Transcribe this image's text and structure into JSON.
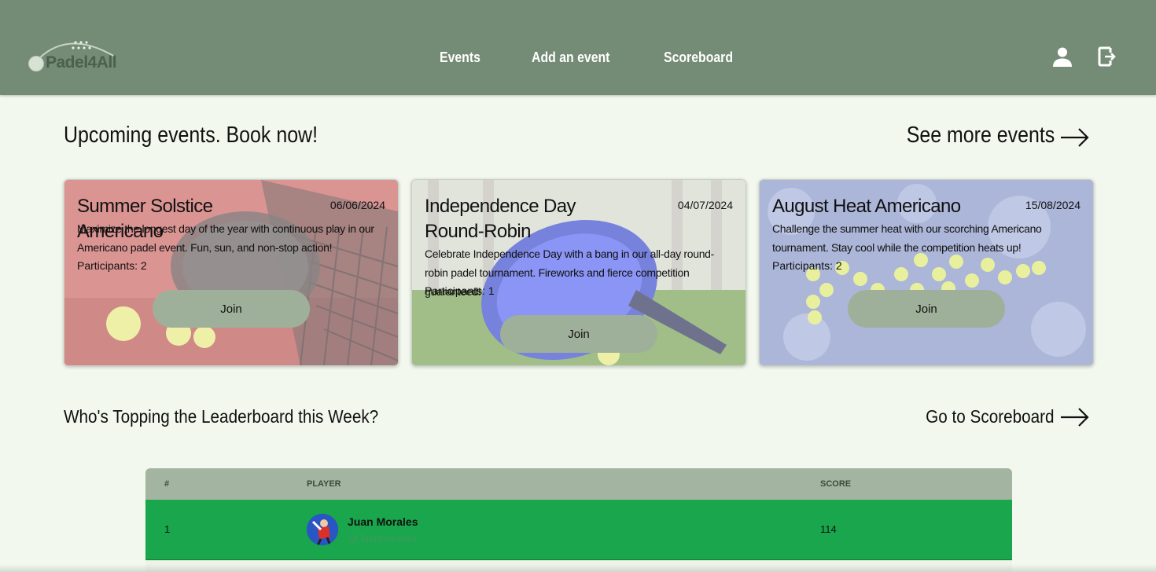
{
  "brand": {
    "name": "Padel4All"
  },
  "nav": {
    "events": "Events",
    "add_event": "Add an event",
    "scoreboard": "Scoreboard"
  },
  "icons": {
    "profile": "person-icon",
    "logout": "logout-icon",
    "arrow": "arrow-right-icon"
  },
  "upcoming": {
    "title": "Upcoming events. Book now!",
    "see_more": "See more events",
    "events": [
      {
        "title": "Summer Solstice Americano",
        "date": "06/06/2024",
        "description": "Maximize the longest day of the year with continuous play in our Americano padel event. Fun, sun, and non-stop action!",
        "participants": "Participants: 2",
        "join": "Join"
      },
      {
        "title": "Independence Day Round-Robin",
        "date": "04/07/2024",
        "description": "Celebrate Independence Day with a bang in our all-day round-robin padel tournament. Fireworks and fierce competition guaranteed!",
        "participants": "Participants: 1",
        "join": "Join"
      },
      {
        "title": "August Heat Americano",
        "date": "15/08/2024",
        "description": "Challenge the summer heat with our scorching Americano tournament. Stay cool while the competition heats up!",
        "participants": "Participants: 2",
        "join": "Join"
      }
    ]
  },
  "leaderboard": {
    "title": "Who's Topping the Leaderboard this Week?",
    "go_link": "Go to Scoreboard",
    "columns": {
      "rank": "#",
      "player": "PLAYER",
      "score": "SCORE"
    },
    "rows": [
      {
        "rank": "1",
        "name": "Juan Morales",
        "handle": "@Juanmorales",
        "score": "114"
      }
    ]
  },
  "colors": {
    "header": "#748b75",
    "page_bg": "#f2f8ee",
    "button": "#9fb09a",
    "table_head": "#a3b5a0",
    "leader_row": "#19a64c"
  }
}
